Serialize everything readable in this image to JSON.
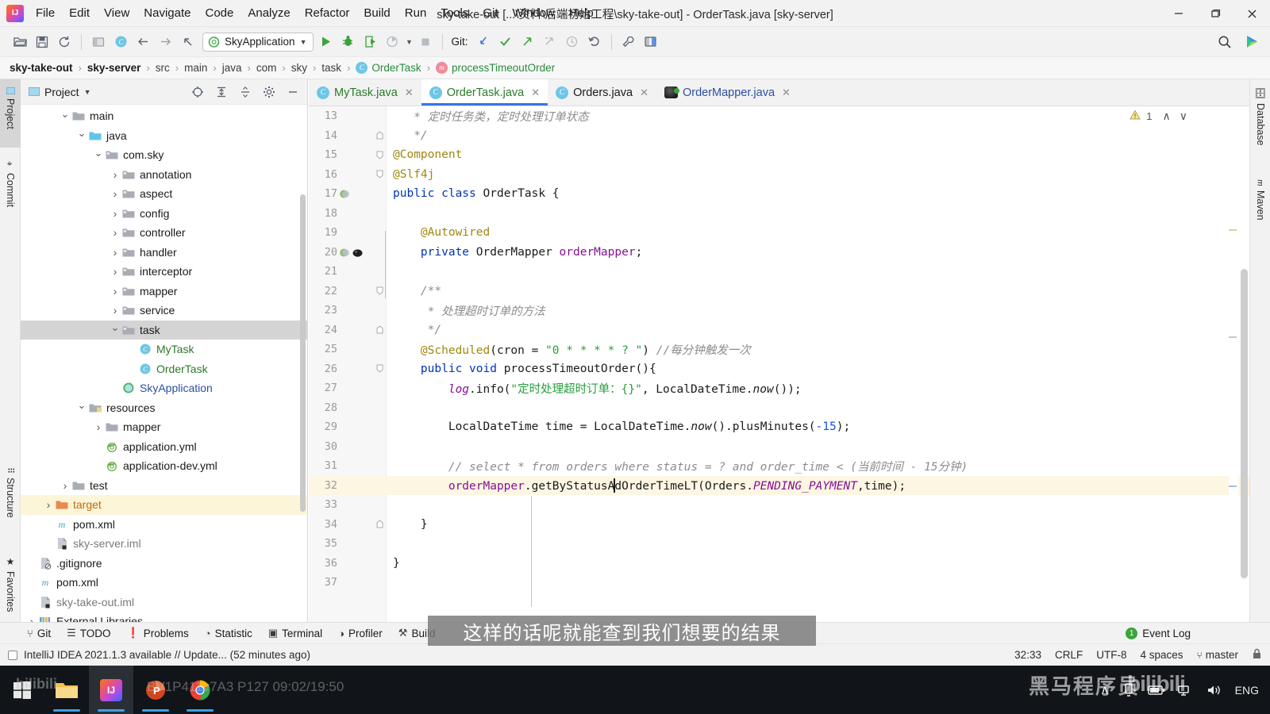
{
  "window": {
    "title": "sky-take-out [...\\资料\\后端初始工程\\sky-take-out] - OrderTask.java [sky-server]",
    "minimize": "—",
    "maximize": "❐",
    "close": "✕"
  },
  "menu": {
    "items": [
      "File",
      "Edit",
      "View",
      "Navigate",
      "Code",
      "Analyze",
      "Refactor",
      "Build",
      "Run",
      "Tools",
      "Git",
      "Window",
      "Help"
    ]
  },
  "toolbar": {
    "run_config": "SkyApplication",
    "git_label": "Git:",
    "icons": [
      "open-folder-icon",
      "save-all-icon",
      "sync-icon",
      "project-structure-icon",
      "compile-icon",
      "back-icon",
      "forward-icon",
      "undo-arrow-icon",
      "run-icon",
      "debug-icon",
      "run-coverage-icon",
      "profile-icon",
      "stop-icon",
      "git-update-icon",
      "git-commit-icon",
      "git-push-icon",
      "git-revert-icon",
      "git-history-icon",
      "rollback-icon",
      "settings-wrench-icon",
      "layout-icon",
      "search-everywhere-icon",
      "ide-feedback-icon"
    ]
  },
  "breadcrumb": {
    "items": [
      {
        "label": "sky-take-out",
        "style": "bold"
      },
      {
        "label": "sky-server",
        "style": "bold"
      },
      {
        "label": "src",
        "style": "plain"
      },
      {
        "label": "main",
        "style": "plain"
      },
      {
        "label": "java",
        "style": "plain"
      },
      {
        "label": "com",
        "style": "plain"
      },
      {
        "label": "sky",
        "style": "plain"
      },
      {
        "label": "task",
        "style": "plain"
      },
      {
        "label": "OrderTask",
        "style": "class",
        "badge": "C"
      },
      {
        "label": "processTimeoutOrder",
        "style": "method",
        "badge": "m"
      }
    ]
  },
  "left_strip": {
    "tabs": [
      "Project",
      "Commit",
      "Structure",
      "Favorites"
    ]
  },
  "right_strip": {
    "tabs": [
      "Database",
      "Maven"
    ]
  },
  "project_panel": {
    "title": "Project",
    "header_icons": [
      "locate-icon",
      "expand-all-icon",
      "collapse-all-icon",
      "settings-gear-icon",
      "hide-icon"
    ],
    "tree": [
      {
        "label": "main",
        "indent": 2,
        "arrow": "down",
        "icon": "folder-gray",
        "state": "normal"
      },
      {
        "label": "java",
        "indent": 3,
        "arrow": "down",
        "icon": "folder-source",
        "state": "normal"
      },
      {
        "label": "com.sky",
        "indent": 4,
        "arrow": "down",
        "icon": "folder-package",
        "state": "normal"
      },
      {
        "label": "annotation",
        "indent": 5,
        "arrow": "right",
        "icon": "folder-package",
        "state": "normal"
      },
      {
        "label": "aspect",
        "indent": 5,
        "arrow": "right",
        "icon": "folder-package",
        "state": "normal"
      },
      {
        "label": "config",
        "indent": 5,
        "arrow": "right",
        "icon": "folder-package",
        "state": "normal"
      },
      {
        "label": "controller",
        "indent": 5,
        "arrow": "right",
        "icon": "folder-package",
        "state": "normal"
      },
      {
        "label": "handler",
        "indent": 5,
        "arrow": "right",
        "icon": "folder-package",
        "state": "normal"
      },
      {
        "label": "interceptor",
        "indent": 5,
        "arrow": "right",
        "icon": "folder-package",
        "state": "normal"
      },
      {
        "label": "mapper",
        "indent": 5,
        "arrow": "right",
        "icon": "folder-package",
        "state": "normal"
      },
      {
        "label": "service",
        "indent": 5,
        "arrow": "right",
        "icon": "folder-package",
        "state": "normal"
      },
      {
        "label": "task",
        "indent": 5,
        "arrow": "down",
        "icon": "folder-package",
        "state": "selected"
      },
      {
        "label": "MyTask",
        "indent": 6,
        "arrow": "none",
        "icon": "class-c",
        "state": "vcs-green"
      },
      {
        "label": "OrderTask",
        "indent": 6,
        "arrow": "none",
        "icon": "class-c",
        "state": "vcs-green"
      },
      {
        "label": "SkyApplication",
        "indent": 5,
        "arrow": "none",
        "icon": "class-spring",
        "state": "blue"
      },
      {
        "label": "resources",
        "indent": 3,
        "arrow": "down",
        "icon": "folder-resources",
        "state": "normal"
      },
      {
        "label": "mapper",
        "indent": 4,
        "arrow": "right",
        "icon": "folder-gray",
        "state": "normal"
      },
      {
        "label": "application.yml",
        "indent": 4,
        "arrow": "none",
        "icon": "yml-spring",
        "state": "normal"
      },
      {
        "label": "application-dev.yml",
        "indent": 4,
        "arrow": "none",
        "icon": "yml-spring",
        "state": "normal"
      },
      {
        "label": "test",
        "indent": 2,
        "arrow": "right",
        "icon": "folder-gray",
        "state": "normal"
      },
      {
        "label": "target",
        "indent": 1,
        "arrow": "right",
        "icon": "folder-excluded",
        "state": "highlight"
      },
      {
        "label": "pom.xml",
        "indent": 1,
        "arrow": "none",
        "icon": "maven-m",
        "state": "normal"
      },
      {
        "label": "sky-server.iml",
        "indent": 1,
        "arrow": "none",
        "icon": "iml-file",
        "state": "gray"
      },
      {
        "label": ".gitignore",
        "indent": 0,
        "arrow": "none",
        "icon": "gitignore-file",
        "state": "normal"
      },
      {
        "label": "pom.xml",
        "indent": 0,
        "arrow": "none",
        "icon": "maven-m",
        "state": "normal"
      },
      {
        "label": "sky-take-out.iml",
        "indent": 0,
        "arrow": "none",
        "icon": "iml-file",
        "state": "gray"
      },
      {
        "label": "External Libraries",
        "indent": 0,
        "arrow": "right",
        "icon": "libraries-icon",
        "state": "normal"
      }
    ]
  },
  "editor_tabs": [
    {
      "label": "MyTask.java",
      "icon": "class-c",
      "color": "green",
      "active": false
    },
    {
      "label": "OrderTask.java",
      "icon": "class-c",
      "color": "green",
      "active": true
    },
    {
      "label": "Orders.java",
      "icon": "class-c",
      "color": "dark",
      "active": false
    },
    {
      "label": "OrderMapper.java",
      "icon": "mybatis-mapper",
      "color": "blue",
      "active": false
    }
  ],
  "editor": {
    "warning_count": "1",
    "warning_icon": "warning-triangle-icon",
    "up_arrow": "∧",
    "down_arrow": "∨",
    "lines": [
      {
        "n": "13",
        "fold": "",
        "gutter": "",
        "tokens": [
          {
            "t": "   * 定时任务类，定时处理订单状态",
            "c": "cmt"
          }
        ]
      },
      {
        "n": "14",
        "fold": "end",
        "gutter": "",
        "tokens": [
          {
            "t": "   */",
            "c": "cmt"
          }
        ]
      },
      {
        "n": "15",
        "fold": "start",
        "gutter": "",
        "tokens": [
          {
            "t": "@Component",
            "c": "ann"
          }
        ]
      },
      {
        "n": "16",
        "fold": "start",
        "gutter": "",
        "tokens": [
          {
            "t": "@Slf4j",
            "c": "ann"
          }
        ]
      },
      {
        "n": "17",
        "fold": "",
        "gutter": "spring",
        "tokens": [
          {
            "t": "public ",
            "c": "k"
          },
          {
            "t": "class ",
            "c": "k"
          },
          {
            "t": "OrderTask {",
            "c": "txt"
          }
        ]
      },
      {
        "n": "18",
        "fold": "",
        "gutter": "",
        "tokens": []
      },
      {
        "n": "19",
        "fold": "",
        "gutter": "",
        "tokens": [
          {
            "t": "    @Autowired",
            "c": "ann"
          }
        ]
      },
      {
        "n": "20",
        "fold": "",
        "gutter": "spring-mybatis",
        "tokens": [
          {
            "t": "    private ",
            "c": "k"
          },
          {
            "t": "OrderMapper ",
            "c": "txt"
          },
          {
            "t": "orderMapper",
            "c": "fld"
          },
          {
            "t": ";",
            "c": "txt"
          }
        ]
      },
      {
        "n": "21",
        "fold": "",
        "gutter": "",
        "tokens": []
      },
      {
        "n": "22",
        "fold": "start",
        "gutter": "",
        "tokens": [
          {
            "t": "    /**",
            "c": "cmt"
          }
        ]
      },
      {
        "n": "23",
        "fold": "",
        "gutter": "",
        "tokens": [
          {
            "t": "     * 处理超时订单的方法",
            "c": "cmt"
          }
        ]
      },
      {
        "n": "24",
        "fold": "end",
        "gutter": "",
        "tokens": [
          {
            "t": "     */",
            "c": "cmt"
          }
        ]
      },
      {
        "n": "25",
        "fold": "",
        "gutter": "",
        "tokens": [
          {
            "t": "    @Scheduled",
            "c": "ann"
          },
          {
            "t": "(cron = ",
            "c": "txt"
          },
          {
            "t": "\"0 * * * * ? \"",
            "c": "str"
          },
          {
            "t": ") ",
            "c": "txt"
          },
          {
            "t": "//每分钟触发一次",
            "c": "cmt"
          }
        ]
      },
      {
        "n": "26",
        "fold": "start",
        "gutter": "",
        "tokens": [
          {
            "t": "    public void ",
            "c": "k"
          },
          {
            "t": "processTimeoutOrder(){",
            "c": "txt"
          }
        ]
      },
      {
        "n": "27",
        "fold": "",
        "gutter": "",
        "tokens": [
          {
            "t": "        log",
            "c": "sfld"
          },
          {
            "t": ".info(",
            "c": "txt"
          },
          {
            "t": "\"定时处理超时订单：{}\"",
            "c": "str"
          },
          {
            "t": ", LocalDateTime.",
            "c": "txt"
          },
          {
            "t": "now",
            "c": "smth"
          },
          {
            "t": "());",
            "c": "txt"
          }
        ]
      },
      {
        "n": "28",
        "fold": "",
        "gutter": "",
        "tokens": []
      },
      {
        "n": "29",
        "fold": "",
        "gutter": "",
        "tokens": [
          {
            "t": "        LocalDateTime time = LocalDateTime.",
            "c": "txt"
          },
          {
            "t": "now",
            "c": "smth"
          },
          {
            "t": "().plusMinutes(",
            "c": "txt"
          },
          {
            "t": "-15",
            "c": "num"
          },
          {
            "t": ");",
            "c": "txt"
          }
        ]
      },
      {
        "n": "30",
        "fold": "",
        "gutter": "",
        "tokens": []
      },
      {
        "n": "31",
        "fold": "",
        "gutter": "",
        "tokens": [
          {
            "t": "        // select * from orders where status = ? and order_time < (当前时间 - 15分钟)",
            "c": "cmt"
          }
        ]
      },
      {
        "n": "32",
        "fold": "",
        "gutter": "",
        "highlight": true,
        "caret_after": "        orderMapper.getByStatusA",
        "tokens": [
          {
            "t": "        ",
            "c": "txt"
          },
          {
            "t": "orderMapper",
            "c": "fld"
          },
          {
            "t": ".getByStatusA",
            "c": "txt"
          },
          {
            "t": "CARET",
            "c": "caret"
          },
          {
            "t": "dOrderTimeLT(Orders.",
            "c": "txt"
          },
          {
            "t": "PENDING_PAYMENT",
            "c": "sfld"
          },
          {
            "t": ",time);",
            "c": "txt"
          }
        ]
      },
      {
        "n": "33",
        "fold": "",
        "gutter": "",
        "tokens": []
      },
      {
        "n": "34",
        "fold": "end",
        "gutter": "",
        "tokens": [
          {
            "t": "    }",
            "c": "txt"
          }
        ]
      },
      {
        "n": "35",
        "fold": "",
        "gutter": "",
        "tokens": []
      },
      {
        "n": "36",
        "fold": "",
        "gutter": "",
        "tokens": [
          {
            "t": "}",
            "c": "txt"
          }
        ]
      },
      {
        "n": "37",
        "fold": "",
        "gutter": "",
        "tokens": []
      }
    ]
  },
  "bottom_bar": {
    "items": [
      {
        "label": "Git",
        "icon": "git-branch-icon"
      },
      {
        "label": "TODO",
        "icon": "todo-list-icon"
      },
      {
        "label": "Problems",
        "icon": "problems-icon"
      },
      {
        "label": "Statistic",
        "icon": "statistic-icon"
      },
      {
        "label": "Terminal",
        "icon": "terminal-icon"
      },
      {
        "label": "Profiler",
        "icon": "profiler-icon"
      },
      {
        "label": "Build",
        "icon": "build-icon"
      }
    ],
    "event_log": "Event Log",
    "event_badge": "1"
  },
  "status_bar": {
    "message": "IntelliJ IDEA 2021.1.3 available // Update... (52 minutes ago)",
    "position": "32:33",
    "line_sep": "CRLF",
    "encoding": "UTF-8",
    "indent": "4 spaces",
    "branch": "master",
    "lock_icon": "lock-icon"
  },
  "taskbar": {
    "items": [
      {
        "name": "start-button",
        "icon": "windows-logo-icon",
        "active": false
      },
      {
        "name": "file-explorer",
        "icon": "folder-icon",
        "active": false
      },
      {
        "name": "intellij-idea",
        "icon": "intellij-icon",
        "active": true
      },
      {
        "name": "powerpoint",
        "icon": "powerpoint-icon",
        "active": false
      },
      {
        "name": "chrome",
        "icon": "chrome-icon",
        "active": false
      }
    ],
    "tray": {
      "expand": "∧",
      "icons": [
        "usb-icon",
        "battery-icon",
        "network-icon",
        "volume-icon"
      ],
      "language": "ENG"
    }
  },
  "overlays": {
    "subtitle": "这样的话呢就能查到我们想要的结果",
    "watermark_brand": "黑马程序员",
    "watermark_bili": "bilibili",
    "watermark_left": "bilibili",
    "watermark_caption": "BV1P411v7A3  P127  09:02/19:50"
  }
}
